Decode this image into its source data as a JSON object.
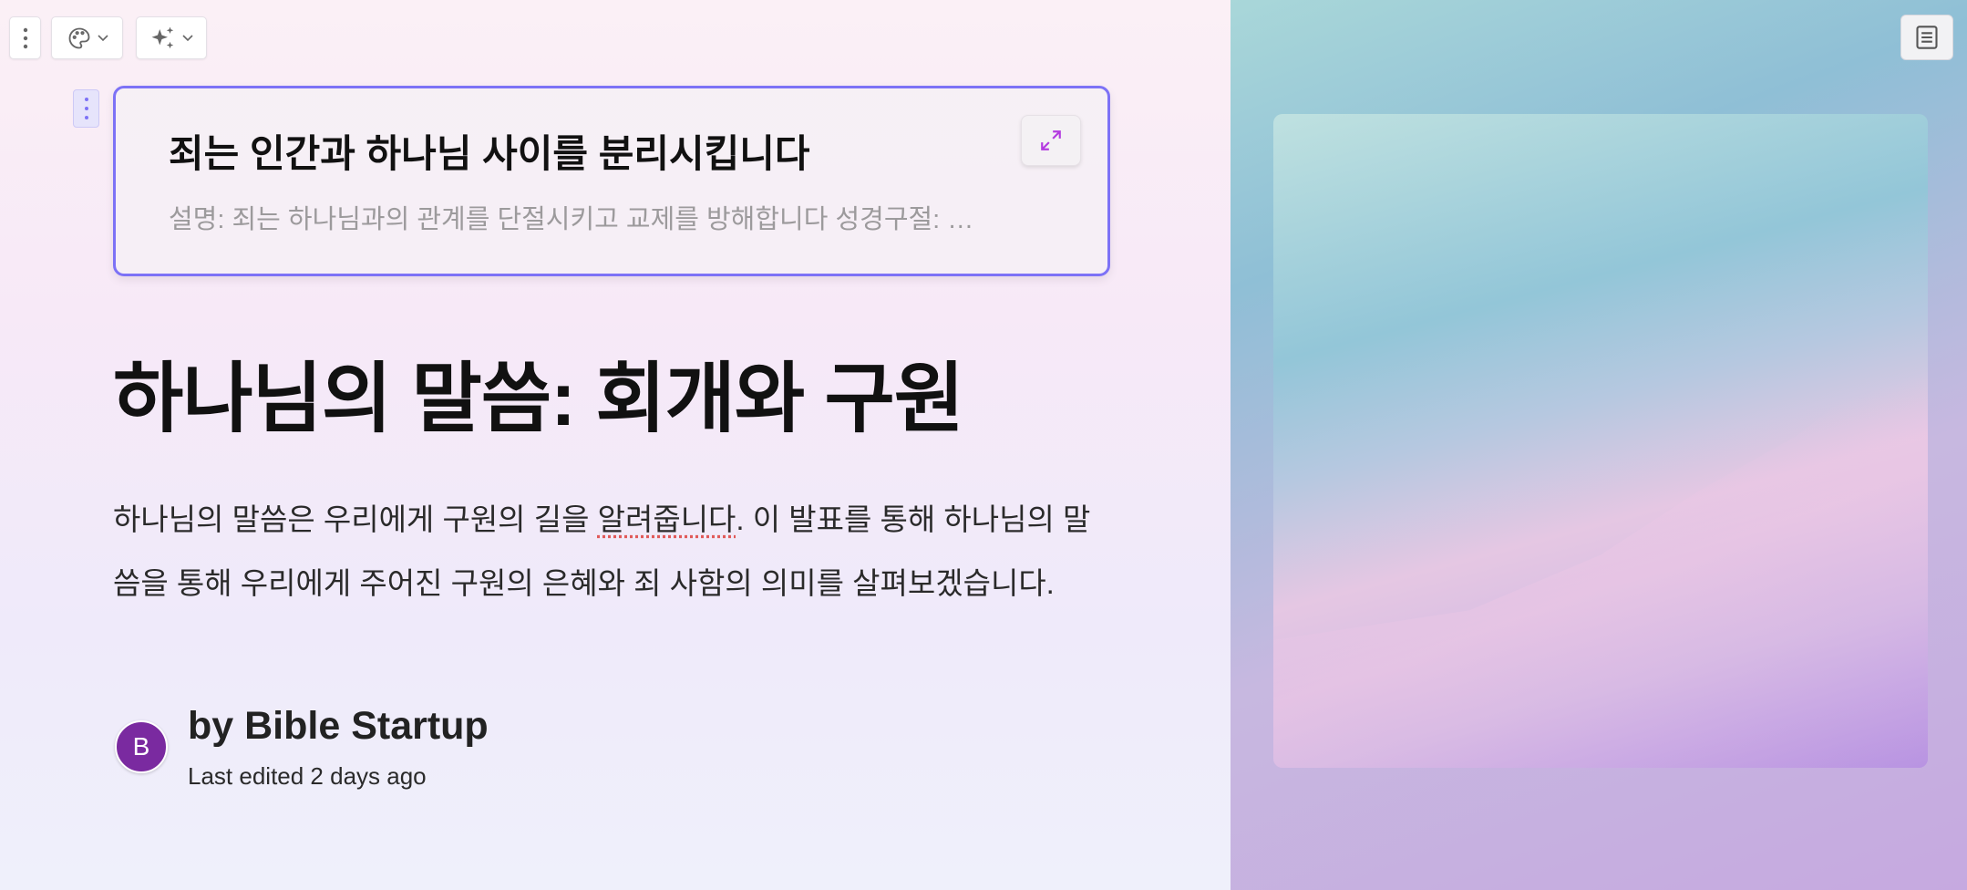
{
  "toolbar": {
    "more": "more-options",
    "theme": "palette",
    "ai": "sparkles"
  },
  "card": {
    "title": "죄는 인간과 하나님 사이를 분리시킵니다",
    "description": "설명: 죄는 하나님과의 관계를 단절시키고 교제를 방해합니다 성경구절: …"
  },
  "page": {
    "title": "하나님의 말씀: 회개와 구원",
    "paragraph_a": "하나님의 말씀은 우리에게 구원의 길을 ",
    "paragraph_spell": "알려줍니다",
    "paragraph_b": ". 이 발표를 통해 하나님의 말씀을 통해 우리에게 주어진 구원의 은혜와 죄 사함의 의미를 살펴보겠습니다."
  },
  "author": {
    "initial": "B",
    "byline": "by Bible Startup",
    "edited": "Last edited 2 days ago"
  },
  "colors": {
    "accent": "#7d72f6",
    "avatar": "#7a2aa0",
    "expand_icon": "#b43be0"
  }
}
